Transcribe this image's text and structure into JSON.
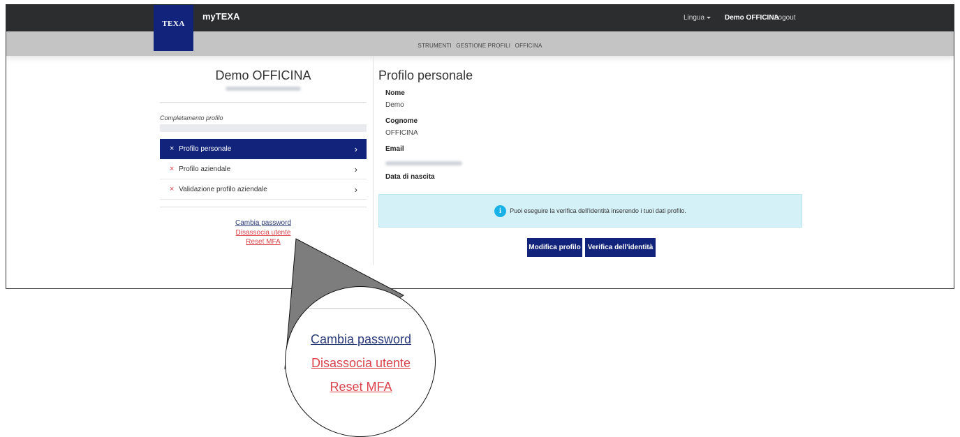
{
  "header": {
    "logo_text": "TEXA",
    "brand": "myTEXA",
    "language_label": "Lingua",
    "user_name": "Demo OFFICINA",
    "logout_label": "Logout"
  },
  "subnav": {
    "items": [
      "STRUMENTI",
      "GESTIONE PROFILI",
      "OFFICINA"
    ]
  },
  "sidebar": {
    "title": "Demo OFFICINA",
    "completion_label": "Completamento profilo",
    "progress_fraction": 0,
    "items": [
      {
        "label": "Profilo personale",
        "active": true
      },
      {
        "label": "Profilo aziendale",
        "active": false
      },
      {
        "label": "Validazione profilo aziendale",
        "active": false
      }
    ],
    "links": {
      "change_password": "Cambia password",
      "disassociate_user": "Disassocia utente",
      "reset_mfa": "Reset MFA"
    }
  },
  "profile": {
    "title": "Profilo personale",
    "nome_label": "Nome",
    "nome_value": "Demo",
    "cognome_label": "Cognome",
    "cognome_value": "OFFICINA",
    "email_label": "Email",
    "birth_label": "Data di nascita"
  },
  "info_box": {
    "icon_glyph": "i",
    "text": "Puoi eseguire la verifica dell'identità inserendo i tuoi dati profilo."
  },
  "buttons": {
    "edit_profile": "Modifica profilo",
    "verify_identity": "Verifica dell'identità"
  },
  "icons": {
    "remove": "×",
    "chevron": "›"
  },
  "colors": {
    "primary": "#11237a",
    "danger": "#d9434b",
    "info_bg": "#d5f1f8",
    "info_icon": "#1ab1e6",
    "topbar": "#2b2d2f",
    "subnav": "#c4c4c4"
  }
}
